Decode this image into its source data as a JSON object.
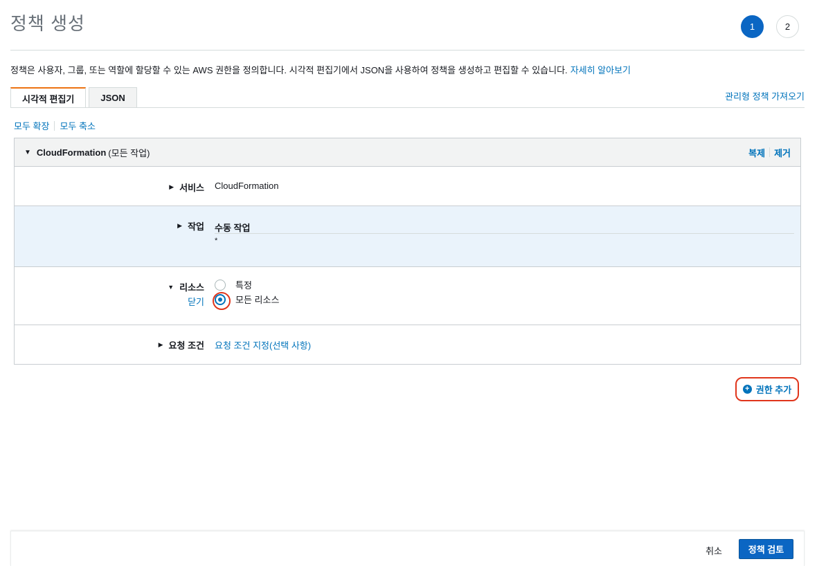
{
  "header": {
    "title": "정책 생성",
    "steps": [
      "1",
      "2"
    ]
  },
  "description": {
    "text": "정책은 사용자, 그룹, 또는 역할에 할당할 수 있는 AWS 권한을 정의합니다. 시각적 편집기에서 JSON을 사용하여 정책을 생성하고 편집할 수 있습니다.",
    "learn_more": "자세히 알아보기"
  },
  "tabs": [
    {
      "label": "시각적 편집기",
      "active": true
    },
    {
      "label": "JSON",
      "active": false
    }
  ],
  "import_managed": "관리형 정책 가져오기",
  "expand_all": "모두 확장",
  "collapse_all": "모두 축소",
  "panel": {
    "service_name": "CloudFormation",
    "service_sub": "(모든 작업)",
    "clone": "복제",
    "remove": "제거",
    "service": {
      "label": "서비스",
      "value": "CloudFormation"
    },
    "actions": {
      "label": "작업",
      "value": "수동 작업",
      "detail": "*"
    },
    "resources": {
      "label": "리소스",
      "close": "닫기",
      "options": [
        {
          "label": "특정",
          "checked": false
        },
        {
          "label": "모든 리소스",
          "checked": true
        }
      ]
    },
    "conditions": {
      "label": "요청 조건",
      "value": "요청 조건 지정(선택 사항)"
    }
  },
  "add_permissions": "권한 추가",
  "footer": {
    "cancel": "취소",
    "review": "정책 검토"
  },
  "colors": {
    "primary": "#0b66c3",
    "link": "#0073bb",
    "tab_accent": "#ec7211",
    "highlight": "#e0351b",
    "selected_row": "#eaf3fb"
  }
}
